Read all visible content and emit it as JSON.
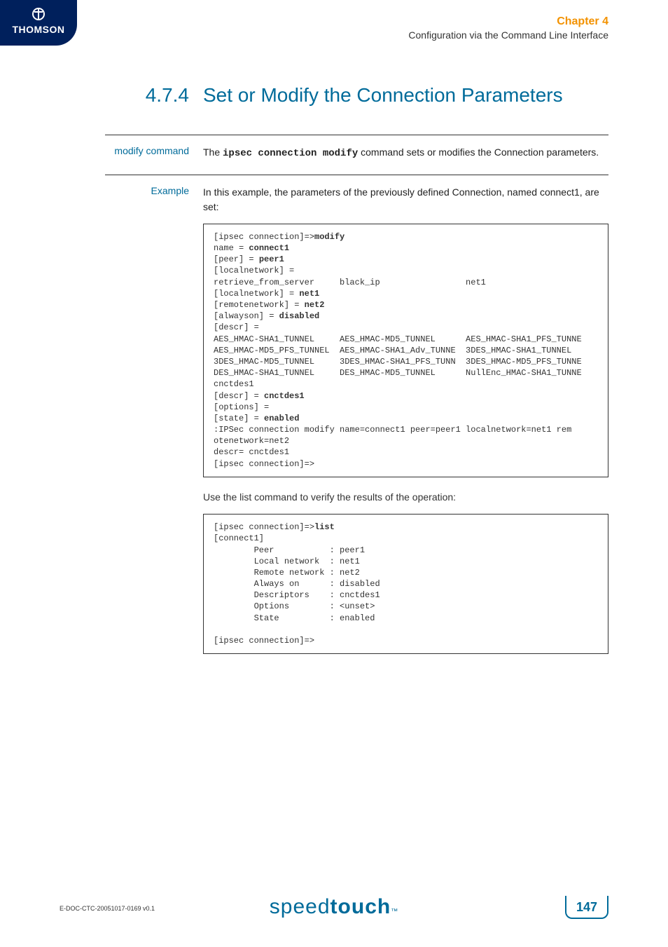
{
  "header": {
    "logo_text": "THOMSON",
    "chapter_label": "Chapter 4",
    "chapter_sub": "Configuration via the Command Line Interface"
  },
  "section": {
    "number": "4.7.4",
    "title": "Set or Modify the Connection Parameters"
  },
  "modify_row": {
    "label": "modify command",
    "text_pre": "The ",
    "text_cmd": "ipsec connection modify",
    "text_post": " command sets or modifies the Connection parameters."
  },
  "example_row": {
    "label": "Example",
    "intro": "In this example, the parameters of the previously defined Connection, named connect1, are set:"
  },
  "code1_lines": [
    {
      "plain": "[ipsec connection]=>",
      "bold": "modify"
    },
    {
      "plain": "name = ",
      "bold": "connect1"
    },
    {
      "plain": "[peer] = ",
      "bold": "peer1"
    },
    {
      "plain": "[localnetwork] =",
      "bold": ""
    },
    {
      "plain": "retrieve_from_server     black_ip                 net1",
      "bold": ""
    },
    {
      "plain": "[localnetwork] = ",
      "bold": "net1"
    },
    {
      "plain": "[remotenetwork] = ",
      "bold": "net2"
    },
    {
      "plain": "[alwayson] = ",
      "bold": "disabled"
    },
    {
      "plain": "[descr] =",
      "bold": ""
    },
    {
      "plain": "AES_HMAC-SHA1_TUNNEL     AES_HMAC-MD5_TUNNEL      AES_HMAC-SHA1_PFS_TUNNE",
      "bold": ""
    },
    {
      "plain": "AES_HMAC-MD5_PFS_TUNNEL  AES_HMAC-SHA1_Adv_TUNNE  3DES_HMAC-SHA1_TUNNEL",
      "bold": ""
    },
    {
      "plain": "3DES_HMAC-MD5_TUNNEL     3DES_HMAC-SHA1_PFS_TUNN  3DES_HMAC-MD5_PFS_TUNNE",
      "bold": ""
    },
    {
      "plain": "DES_HMAC-SHA1_TUNNEL     DES_HMAC-MD5_TUNNEL      NullEnc_HMAC-SHA1_TUNNE",
      "bold": ""
    },
    {
      "plain": "cnctdes1",
      "bold": ""
    },
    {
      "plain": "[descr] = ",
      "bold": "cnctdes1"
    },
    {
      "plain": "[options] =",
      "bold": ""
    },
    {
      "plain": "[state] = ",
      "bold": "enabled"
    },
    {
      "plain": ":IPSec connection modify name=connect1 peer=peer1 localnetwork=net1 rem",
      "bold": ""
    },
    {
      "plain": "otenetwork=net2",
      "bold": ""
    },
    {
      "plain": "descr= cnctdes1",
      "bold": ""
    },
    {
      "plain": "[ipsec connection]=>",
      "bold": ""
    }
  ],
  "after_code1": "Use the list command to verify the results of the operation:",
  "code2_lines": [
    {
      "plain": "[ipsec connection]=>",
      "bold": "list"
    },
    {
      "plain": "[connect1]",
      "bold": ""
    },
    {
      "plain": "        Peer           : peer1",
      "bold": ""
    },
    {
      "plain": "        Local network  : net1",
      "bold": ""
    },
    {
      "plain": "        Remote network : net2",
      "bold": ""
    },
    {
      "plain": "        Always on      : disabled",
      "bold": ""
    },
    {
      "plain": "        Descriptors    : cnctdes1",
      "bold": ""
    },
    {
      "plain": "        Options        : <unset>",
      "bold": ""
    },
    {
      "plain": "        State          : enabled",
      "bold": ""
    },
    {
      "plain": "",
      "bold": ""
    },
    {
      "plain": "[ipsec connection]=>",
      "bold": ""
    }
  ],
  "footer": {
    "doc_id": "E-DOC-CTC-20051017-0169 v0.1",
    "brand_light": "speed",
    "brand_bold": "touch",
    "page_number": "147"
  }
}
